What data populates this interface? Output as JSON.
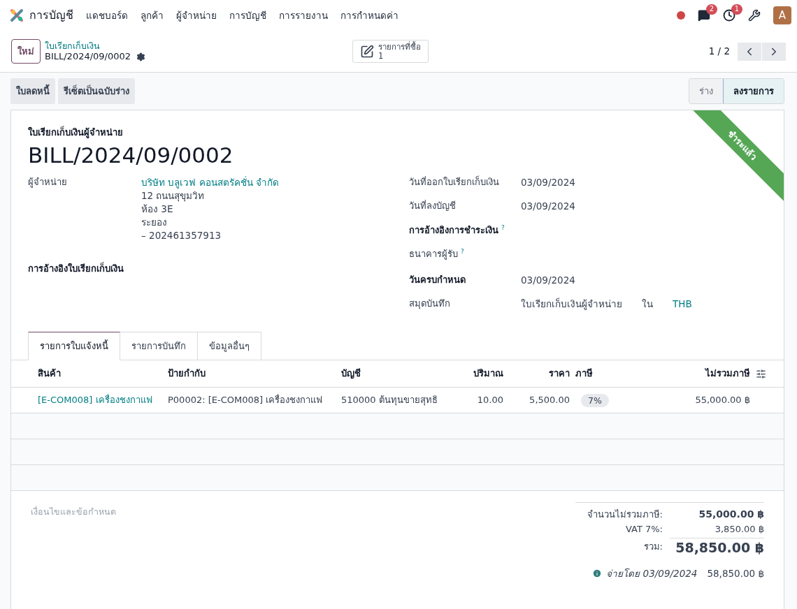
{
  "navbar": {
    "app_name": "การบัญชี",
    "menu": [
      "แดชบอร์ด",
      "ลูกค้า",
      "ผู้จำหน่าย",
      "การบัญชี",
      "การรายงาน",
      "การกำหนดค่า"
    ],
    "messages_badge": "2",
    "activities_badge": "1",
    "avatar": "A"
  },
  "control_panel": {
    "new_button": "ใหม่",
    "breadcrumb_parent": "ใบเรียกเก็บเงิน",
    "breadcrumb_current": "BILL/2024/09/0002",
    "smart_button": {
      "label": "รายการที่ซื้อ",
      "count": "1"
    },
    "pager": "1 / 2"
  },
  "actions": [
    "ใบลดหนี้",
    "รีเซ็ตเป็นฉบับร่าง"
  ],
  "status_bar": [
    {
      "label": "ร่าง",
      "selected": false
    },
    {
      "label": "ลงรายการ",
      "selected": true
    }
  ],
  "sheet": {
    "ribbon": "ชำระแล้ว",
    "subtitle": "ใบเรียกเก็บเงินผู้จำหน่าย",
    "title": "BILL/2024/09/0002",
    "vendor": {
      "label": "ผู้จำหน่าย",
      "name": "บริษัท บลูเวฟ คอนสตรัคชั่น จำกัด",
      "address": [
        "12 ถนนสุขุมวิท",
        "ห้อง 3E",
        "ระยอง",
        "– 202461357913"
      ]
    },
    "bill_reference": {
      "label": "การอ้างอิงใบเรียกเก็บเงิน"
    },
    "right_fields": [
      {
        "label": "วันที่ออกใบเรียกเก็บเงิน",
        "value": "03/09/2024",
        "required": false
      },
      {
        "label": "วันที่ลงบัญชี",
        "value": "03/09/2024",
        "required": false
      },
      {
        "label": "การอ้างอิงการชำระเงิน",
        "help": "?",
        "required": true
      },
      {
        "label": "ธนาคารผู้รับ",
        "help": "?",
        "required": false
      },
      {
        "label": "วันครบกำหนด",
        "value": "03/09/2024",
        "required": true
      },
      {
        "label": "สมุดบันทึก",
        "value": "ใบเรียกเก็บเงินผู้จำหน่าย",
        "in": "ใน",
        "currency": "THB",
        "required": false
      }
    ]
  },
  "tabs": [
    {
      "label": "รายการใบแจ้งหนี้",
      "selected": true
    },
    {
      "label": "รายการบันทึก",
      "selected": false
    },
    {
      "label": "ข้อมูลอื่นๆ",
      "selected": false
    }
  ],
  "table": {
    "columns": [
      "สินค้า",
      "ป้ายกำกับ",
      "บัญชี",
      "ปริมาณ",
      "ราคา",
      "ภาษี",
      "ไม่รวมภาษี"
    ],
    "rows": [
      {
        "product": "[E-COM008] เครื่องชงกาแฟ",
        "label": "P00002: [E-COM008] เครื่องชงกาแฟ",
        "account": "510000 ต้นทุนขายสุทธิ",
        "quantity": "10.00",
        "price": "5,500.00",
        "tax": "7%",
        "subtotal": "55,000.00 ฿"
      }
    ]
  },
  "terms_placeholder": "เงื่อนไขและข้อกำหนด",
  "totals": [
    {
      "label": "จำนวนไม่รวมภาษี:",
      "value": "55,000.00 ฿",
      "kind": "subtotal"
    },
    {
      "label": "VAT 7%:",
      "value": "3,850.00 ฿",
      "kind": "tax"
    },
    {
      "label": "รวม:",
      "value": "58,850.00 ฿",
      "kind": "total"
    }
  ],
  "payment": {
    "text": "จ่ายโดย 03/09/2024",
    "amount": "58,850.00 ฿"
  }
}
